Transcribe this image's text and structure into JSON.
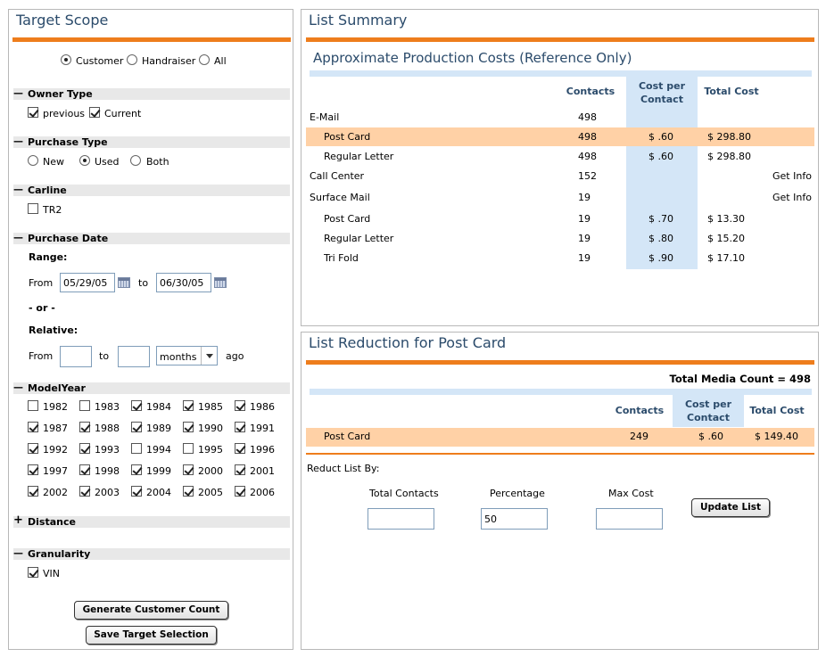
{
  "left": {
    "title": "Target Scope",
    "scope_options": [
      {
        "label": "Customer",
        "checked": true
      },
      {
        "label": "Handraiser",
        "checked": false
      },
      {
        "label": "All",
        "checked": false
      }
    ],
    "owner_type": {
      "header": "Owner Type",
      "toggle": "—",
      "options": [
        {
          "label": "previous",
          "checked": true
        },
        {
          "label": "Current",
          "checked": true
        }
      ]
    },
    "purchase_type": {
      "header": "Purchase Type",
      "toggle": "—",
      "options": [
        {
          "label": "New",
          "checked": false
        },
        {
          "label": "Used",
          "checked": true
        },
        {
          "label": "Both",
          "checked": false
        }
      ]
    },
    "carline": {
      "header": "Carline",
      "toggle": "—",
      "options": [
        {
          "label": "TR2",
          "checked": false
        }
      ]
    },
    "purchase_date": {
      "header": "Purchase Date",
      "toggle": "—",
      "range_label": "Range:",
      "from_label": "From",
      "from_value": "05/29/05",
      "to_label": "to",
      "to_value": "06/30/05",
      "or_label": "- or -",
      "relative_label": "Relative:",
      "rel_from_label": "From",
      "rel_from_value": "",
      "rel_to_label": "to",
      "rel_to_value": "",
      "unit_value": "months",
      "ago_label": "ago"
    },
    "model_year": {
      "header": "ModelYear",
      "toggle": "—",
      "years": [
        {
          "label": "1982",
          "checked": false
        },
        {
          "label": "1983",
          "checked": false
        },
        {
          "label": "1984",
          "checked": true
        },
        {
          "label": "1985",
          "checked": true
        },
        {
          "label": "1986",
          "checked": true
        },
        {
          "label": "1987",
          "checked": true
        },
        {
          "label": "1988",
          "checked": true
        },
        {
          "label": "1989",
          "checked": true
        },
        {
          "label": "1990",
          "checked": true
        },
        {
          "label": "1991",
          "checked": true
        },
        {
          "label": "1992",
          "checked": true
        },
        {
          "label": "1993",
          "checked": true
        },
        {
          "label": "1994",
          "checked": false
        },
        {
          "label": "1995",
          "checked": false
        },
        {
          "label": "1996",
          "checked": true
        },
        {
          "label": "1997",
          "checked": true
        },
        {
          "label": "1998",
          "checked": true
        },
        {
          "label": "1999",
          "checked": true
        },
        {
          "label": "2000",
          "checked": true
        },
        {
          "label": "2001",
          "checked": true
        },
        {
          "label": "2002",
          "checked": true
        },
        {
          "label": "2003",
          "checked": true
        },
        {
          "label": "2004",
          "checked": true
        },
        {
          "label": "2005",
          "checked": true
        },
        {
          "label": "2006",
          "checked": true
        }
      ]
    },
    "distance": {
      "header": "Distance",
      "toggle": "+"
    },
    "granularity": {
      "header": "Granularity",
      "toggle": "—",
      "options": [
        {
          "label": "VIN",
          "checked": true
        }
      ]
    },
    "generate_button": "Generate Customer Count",
    "save_button": "Save Target Selection"
  },
  "summary": {
    "title": "List Summary",
    "subtitle": "Approximate Production Costs (Reference Only)",
    "col_contacts": "Contacts",
    "col_cpc": "Cost per Contact",
    "col_total": "Total Cost",
    "rows": [
      {
        "name": "E-Mail",
        "contacts": "498",
        "cpc": "",
        "total": "",
        "info": ""
      },
      {
        "name": "Post Card",
        "contacts": "498",
        "cpc": "$ .60",
        "total": "$ 298.80",
        "info": ""
      },
      {
        "name": "Regular Letter",
        "contacts": "498",
        "cpc": "$ .60",
        "total": "$ 298.80",
        "info": ""
      },
      {
        "name": "Call Center",
        "contacts": "152",
        "cpc": "",
        "total": "",
        "info": "Get Info"
      },
      {
        "name": "Surface Mail",
        "contacts": "19",
        "cpc": "",
        "total": "",
        "info": "Get Info"
      },
      {
        "name": "Post Card",
        "contacts": "19",
        "cpc": "$ .70",
        "total": "$ 13.30",
        "info": ""
      },
      {
        "name": "Regular Letter",
        "contacts": "19",
        "cpc": "$ .80",
        "total": "$ 15.20",
        "info": ""
      },
      {
        "name": "Tri Fold",
        "contacts": "19",
        "cpc": "$ .90",
        "total": "$ 17.10",
        "info": ""
      }
    ]
  },
  "reduction": {
    "title": "List Reduction for Post Card",
    "total_media": "Total Media Count = 498",
    "col_contacts": "Contacts",
    "col_cpc": "Cost per Contact",
    "col_total": "Total Cost",
    "row": {
      "name": "Post Card",
      "contacts": "249",
      "cpc": "$ .60",
      "total": "$ 149.40"
    },
    "reduce_by_label": "Reduct List By:",
    "total_contacts_label": "Total Contacts",
    "total_contacts_value": "",
    "percentage_label": "Percentage",
    "percentage_value": "50",
    "max_cost_label": "Max Cost",
    "max_cost_value": "",
    "update_button": "Update List"
  },
  "colors": {
    "accent": "#ee7d1c",
    "title": "#2b4b6b",
    "highlight": "#ffd1a6",
    "column": "#d4e6f7"
  }
}
